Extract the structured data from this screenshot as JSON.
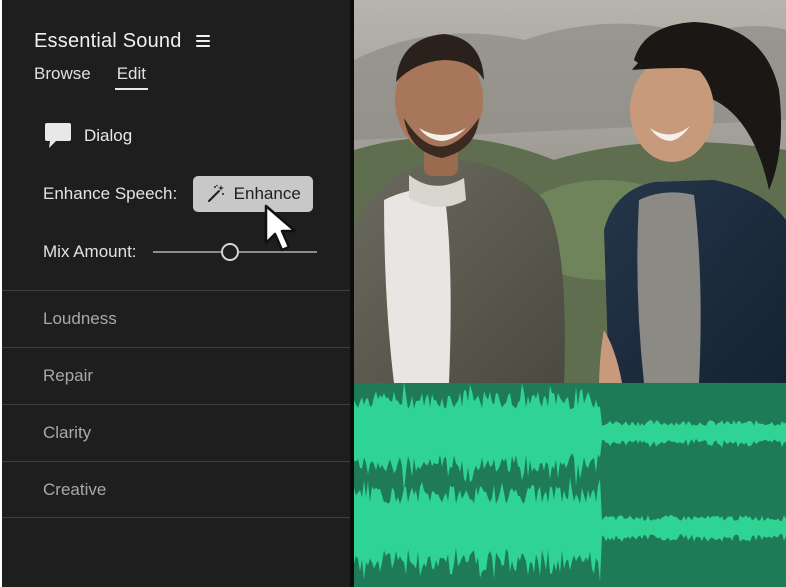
{
  "panel": {
    "title": "Essential Sound",
    "tabs": [
      {
        "label": "Browse",
        "active": false
      },
      {
        "label": "Edit",
        "active": true
      }
    ],
    "dialog_label": "Dialog",
    "enhance_speech_label": "Enhance Speech:",
    "enhance_button_label": "Enhance",
    "mix_amount_label": "Mix Amount:",
    "mix_amount_value": 0.47,
    "sections": [
      {
        "label": "Loudness"
      },
      {
        "label": "Repair"
      },
      {
        "label": "Clarity"
      },
      {
        "label": "Creative"
      }
    ]
  },
  "colors": {
    "panel_bg": "#1e1e1e",
    "waveform_bg": "#1e7a57",
    "waveform_fill": "#2fd393",
    "button_bg": "#c8c8c8"
  },
  "icons": {
    "menu": "hamburger-menu-icon",
    "dialog": "speech-bubble-icon",
    "enhance": "magic-wand-icon",
    "cursor": "mouse-pointer-icon"
  }
}
